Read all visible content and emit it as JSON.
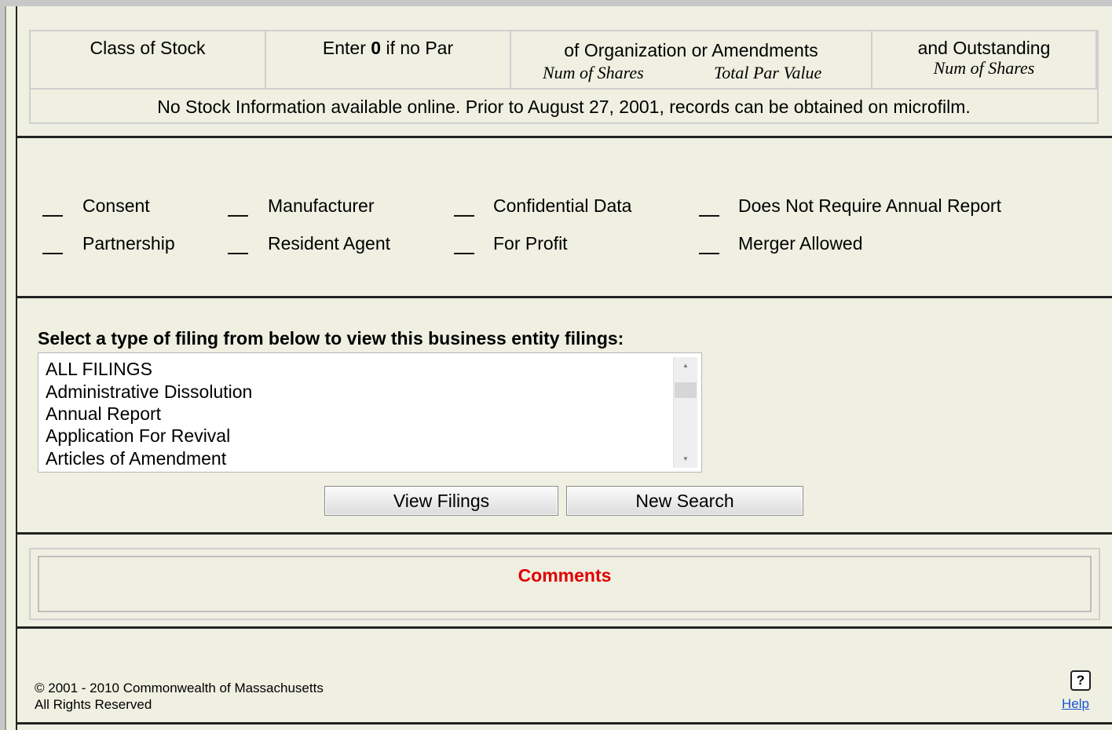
{
  "stock": {
    "columns": [
      {
        "header": "Class of Stock",
        "sub": []
      },
      {
        "header_pre": "Enter ",
        "header_bold": "0",
        "header_post": " if no Par",
        "sub": []
      },
      {
        "header": "of Organization or Amendments",
        "sub": [
          "Num of Shares",
          "Total Par Value"
        ]
      },
      {
        "header": "and Outstanding",
        "sub": [
          "Num of Shares"
        ]
      }
    ],
    "message": "No Stock Information available online. Prior to August 27, 2001, records can be obtained on microfilm."
  },
  "attributes": {
    "row1": [
      "Consent",
      "Manufacturer",
      "Confidential Data",
      "Does Not Require Annual Report"
    ],
    "row2": [
      "Partnership",
      "Resident Agent",
      "For Profit",
      "Merger Allowed"
    ]
  },
  "filings": {
    "label": "Select a type of filing from below to view this business entity filings:",
    "options": [
      "ALL FILINGS",
      "Administrative Dissolution",
      "Annual Report",
      "Application For Revival",
      "Articles of Amendment"
    ]
  },
  "buttons": {
    "view_filings": "View Filings",
    "new_search": "New Search"
  },
  "comments": {
    "title": "Comments",
    "title_color": "#e00000"
  },
  "footer": {
    "copyright": "© 2001 - 2010 Commonwealth of Massachusetts",
    "rights": "All Rights Reserved",
    "help_icon_glyph": "?",
    "help_label": "Help"
  }
}
